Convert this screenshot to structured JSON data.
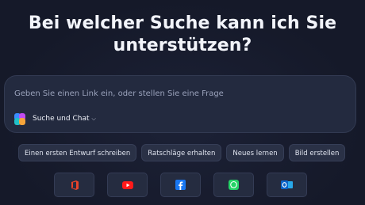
{
  "headline": {
    "line1": "Bei welcher Suche kann ich Sie",
    "line2": "unterstützen?"
  },
  "chat": {
    "placeholder": "Geben Sie einen Link ein, oder stellen Sie eine Frage",
    "mode_label": "Suche und Chat",
    "mode_icon": "chevron-down-icon"
  },
  "suggestions": [
    "Einen ersten Entwurf schreiben",
    "Ratschläge erhalten",
    "Neues lernen",
    "Bild erstellen"
  ],
  "apps": [
    {
      "name": "office-icon",
      "color": "#e8432a"
    },
    {
      "name": "youtube-icon",
      "color": "#ff1a1a"
    },
    {
      "name": "facebook-icon",
      "color": "#1877f2"
    },
    {
      "name": "whatsapp-icon",
      "color": "#25d366"
    },
    {
      "name": "outlook-icon",
      "color": "#0a64c8"
    }
  ],
  "colors": {
    "background": "#161a2c",
    "panel": "#232a3f",
    "text": "#f2f4fa"
  }
}
